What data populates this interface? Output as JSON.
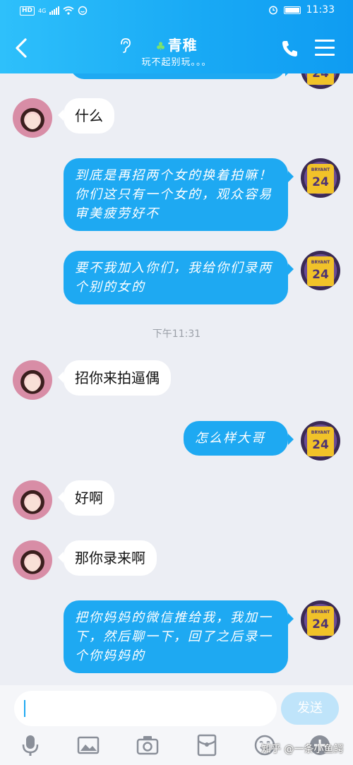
{
  "status": {
    "network_badge": "HD",
    "network_type": "4G",
    "time": "11:33"
  },
  "header": {
    "title": "青稚",
    "subtitle": "玩不起别玩。。。"
  },
  "messages": [
    {
      "from": "them",
      "text": "什么"
    },
    {
      "from": "me",
      "text": "到底是再招两个女的换着拍嘛！你们这只有一个女的，观众容易审美疲劳好不"
    },
    {
      "from": "me",
      "text": "要不我加入你们，我给你们录两个别的女的"
    },
    {
      "from": "time",
      "text": "下午11:31"
    },
    {
      "from": "them",
      "text": "招你来拍逼偶"
    },
    {
      "from": "me",
      "text": "怎么样大哥"
    },
    {
      "from": "them",
      "text": "好啊"
    },
    {
      "from": "them",
      "text": "那你录来啊"
    },
    {
      "from": "me",
      "text": "把你妈妈的微信推给我，我加一下，然后聊一下，回了之后录一个你妈妈的"
    }
  ],
  "avatar_me": {
    "number": "24",
    "name": "BRYANT"
  },
  "composer": {
    "placeholder": "",
    "send_label": "发送"
  },
  "watermark": "知乎 @一条小鱼鳄",
  "colors": {
    "header_gradient_start": "#2ec0fb",
    "header_gradient_end": "#0f9cf2",
    "outgoing_bubble": "#1ea9f2",
    "incoming_bubble": "#ffffff",
    "background": "#eceef4"
  }
}
